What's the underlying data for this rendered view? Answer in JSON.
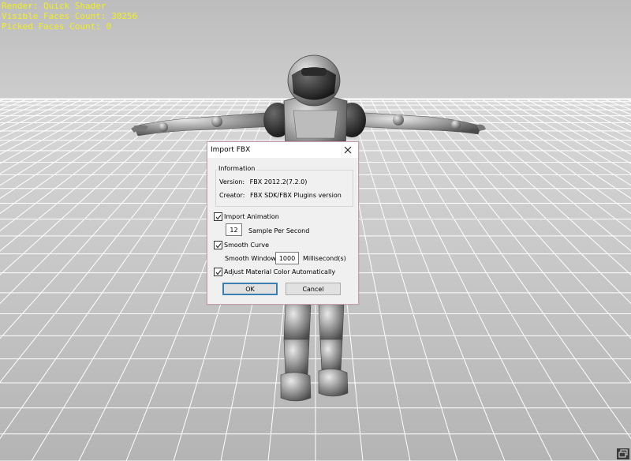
{
  "viewport": {
    "render_label": "Render: Quick Shader",
    "visible_faces_label": "Visible Faces Count: 30256",
    "picked_faces_label": "Picked Faces Count: 0",
    "stats_color": "#f2ee1e",
    "background_color": "#c8c8c8",
    "grid_color": "#ffffff",
    "corner_icon": "windows-restore-icon"
  },
  "dialog": {
    "title": "Import FBX",
    "close_icon": "close-icon",
    "information": {
      "caption": "Information",
      "version_label": "Version:",
      "version_value": "FBX 2012.2(7.2.0)",
      "creator_label": "Creator:",
      "creator_value": "FBX SDK/FBX Plugins version"
    },
    "import_animation": {
      "label": "Import Animation",
      "checked": true
    },
    "sample_rate": {
      "value": "12",
      "label": "Sample Per Second"
    },
    "smooth_curve": {
      "label": "Smooth Curve",
      "checked": true
    },
    "smooth_window": {
      "label": "Smooth Window:",
      "value": "1000",
      "unit": "Millisecond(s)"
    },
    "adjust_material": {
      "label": "Adjust Material Color Automatically",
      "checked": true
    },
    "ok_label": "OK",
    "cancel_label": "Cancel"
  }
}
